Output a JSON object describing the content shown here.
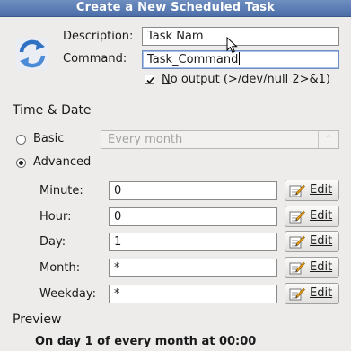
{
  "window": {
    "title": "Create a New Scheduled Task"
  },
  "form": {
    "description_label": "Description:",
    "description_value": "Task Nam",
    "command_label": "Command:",
    "command_value": "Task_Command",
    "no_output_label": "No output (>/dev/null 2>&1)",
    "no_output_checked": true
  },
  "time_date": {
    "heading": "Time & Date",
    "basic_label": "Basic",
    "basic_selected": false,
    "basic_combo_value": "Every month",
    "advanced_label": "Advanced",
    "advanced_selected": true
  },
  "fields": [
    {
      "label": "Minute:",
      "value": "0"
    },
    {
      "label": "Hour:",
      "value": "0"
    },
    {
      "label": "Day:",
      "value": "1"
    },
    {
      "label": "Month:",
      "value": "*"
    },
    {
      "label": "Weekday:",
      "value": "*"
    }
  ],
  "edit_button_label": "Edit",
  "preview": {
    "heading": "Preview",
    "text": "On day 1 of every month at 00:00"
  },
  "icons": {
    "app": "refresh-icon",
    "edit": "pencil-edit-icon",
    "pointer": "mouse-pointer-icon"
  }
}
